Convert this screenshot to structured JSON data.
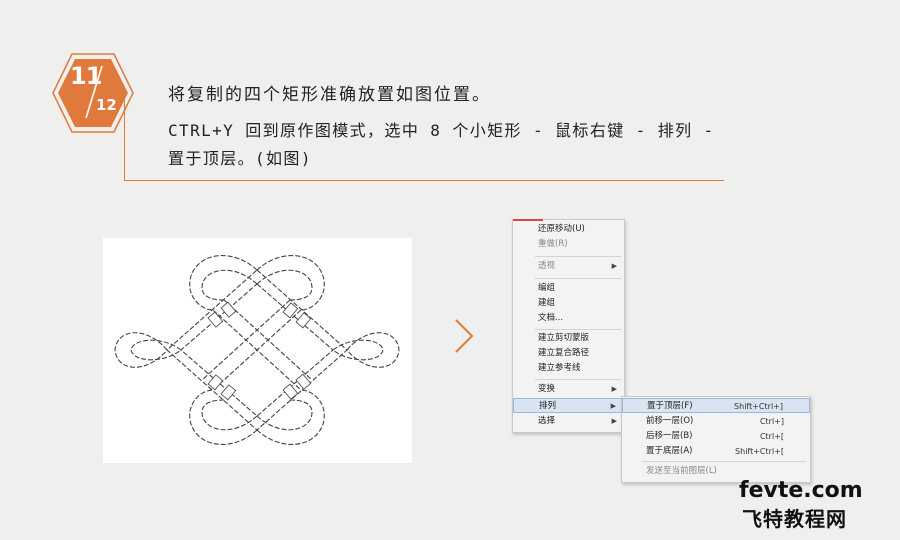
{
  "step": {
    "current": "11",
    "total": "12"
  },
  "instructions": {
    "line1": "将复制的四个矩形准确放置如图位置。",
    "line2": "CTRL+Y 回到原作图模式，选中 8 个小矩形 - 鼠标右键 - 排列 - 置于顶层。(如图)"
  },
  "context_menu": {
    "items": [
      {
        "label": "还原移动(U)",
        "dim": false
      },
      {
        "label": "重做(R)",
        "dim": true
      },
      {
        "label": "透视",
        "dim": true,
        "submenu": true
      },
      {
        "label": "编组",
        "dim": false
      },
      {
        "label": "建组",
        "dim": false
      },
      {
        "label": "文档...",
        "dim": false
      },
      {
        "label": "建立剪切蒙版",
        "dim": false
      },
      {
        "label": "建立复合路径",
        "dim": false
      },
      {
        "label": "建立参考线",
        "dim": false
      },
      {
        "label": "变换",
        "dim": false,
        "submenu": true
      },
      {
        "label": "排列",
        "dim": false,
        "submenu": true,
        "highlighted": true
      },
      {
        "label": "选择",
        "dim": false,
        "submenu": true
      }
    ],
    "arrange_submenu": [
      {
        "label": "置于顶层(F)",
        "shortcut": "Shift+Ctrl+]",
        "highlighted": true
      },
      {
        "label": "前移一层(O)",
        "shortcut": "Ctrl+]"
      },
      {
        "label": "后移一层(B)",
        "shortcut": "Ctrl+["
      },
      {
        "label": "置于底层(A)",
        "shortcut": "Shift+Ctrl+["
      },
      {
        "label": "发送至当前图层(L)",
        "shortcut": "",
        "dim": true
      }
    ]
  },
  "watermark": {
    "domain": "fevte.com",
    "name": "飞特教程网"
  },
  "colors": {
    "accent": "#e07a3c",
    "background": "#efefee"
  }
}
